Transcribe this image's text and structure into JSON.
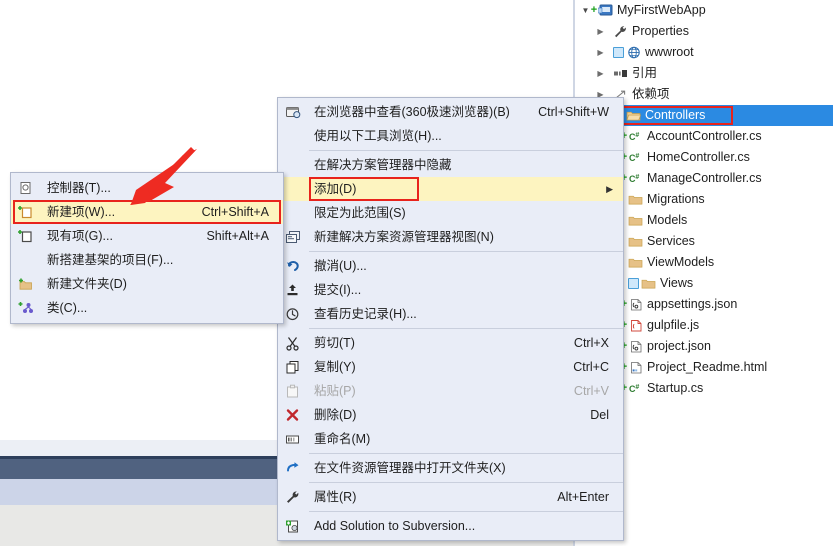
{
  "solution_explorer": {
    "name": "solution-explorer",
    "items": [
      {
        "label": "MyFirstWebApp",
        "icon": "project-icon",
        "indent": 0,
        "expander": "open",
        "plus": true,
        "selected": false
      },
      {
        "label": "Properties",
        "icon": "wrench-icon",
        "indent": 1,
        "expander": "closed",
        "plus": false,
        "selected": false
      },
      {
        "label": "wwwroot",
        "icon": "globe-icon",
        "indent": 1,
        "expander": "closed",
        "plus": false,
        "selected": false,
        "lock": true
      },
      {
        "label": "引用",
        "icon": "references-icon",
        "indent": 1,
        "expander": "closed",
        "plus": false,
        "selected": false
      },
      {
        "label": "依赖项",
        "icon": "dependencies-icon",
        "indent": 1,
        "expander": "closed",
        "plus": false,
        "selected": false
      },
      {
        "label": "Controllers",
        "icon": "folder-open-icon",
        "indent": 1,
        "expander": "open",
        "plus": false,
        "selected": true,
        "lock": true
      },
      {
        "label": "AccountController.cs",
        "icon": "csharp-icon",
        "indent": 2,
        "expander": "closed",
        "plus": true,
        "selected": false
      },
      {
        "label": "HomeController.cs",
        "icon": "csharp-icon",
        "indent": 2,
        "expander": "closed",
        "plus": true,
        "selected": false
      },
      {
        "label": "ManageController.cs",
        "icon": "csharp-icon",
        "indent": 2,
        "expander": "closed",
        "plus": true,
        "selected": false
      },
      {
        "label": "Migrations",
        "icon": "folder-icon",
        "indent": 2,
        "expander": "none",
        "plus": false,
        "selected": false
      },
      {
        "label": "Models",
        "icon": "folder-icon",
        "indent": 2,
        "expander": "none",
        "plus": false,
        "selected": false
      },
      {
        "label": "Services",
        "icon": "folder-icon",
        "indent": 2,
        "expander": "none",
        "plus": false,
        "selected": false
      },
      {
        "label": "ViewModels",
        "icon": "folder-icon",
        "indent": 2,
        "expander": "none",
        "plus": false,
        "selected": false
      },
      {
        "label": "Views",
        "icon": "folder-icon",
        "indent": 2,
        "expander": "none",
        "plus": false,
        "selected": false,
        "lock": true
      },
      {
        "label": "appsettings.json",
        "icon": "json-icon",
        "indent": 2,
        "expander": "none",
        "plus": true,
        "selected": false
      },
      {
        "label": "gulpfile.js",
        "icon": "gulp-icon",
        "indent": 2,
        "expander": "none",
        "plus": true,
        "selected": false
      },
      {
        "label": "project.json",
        "icon": "json-icon",
        "indent": 2,
        "expander": "none",
        "plus": true,
        "selected": false
      },
      {
        "label": "Project_Readme.html",
        "icon": "html-icon",
        "indent": 2,
        "expander": "none",
        "plus": true,
        "selected": false
      },
      {
        "label": "Startup.cs",
        "icon": "csharp-icon",
        "indent": 2,
        "expander": "none",
        "plus": true,
        "selected": false
      }
    ]
  },
  "context_menu": {
    "name": "solution-explorer-context-menu",
    "items": [
      {
        "type": "item",
        "label": "在浏览器中查看(360极速浏览器)(B)",
        "shortcut": "Ctrl+Shift+W",
        "icon": "browser-icon",
        "disabled": false,
        "highlight": false,
        "submenu": false
      },
      {
        "type": "item",
        "label": "使用以下工具浏览(H)...",
        "shortcut": "",
        "icon": "none",
        "disabled": false,
        "highlight": false,
        "submenu": false
      },
      {
        "type": "separator"
      },
      {
        "type": "item",
        "label": "在解决方案管理器中隐藏",
        "shortcut": "",
        "icon": "none",
        "disabled": false,
        "highlight": false,
        "submenu": false
      },
      {
        "type": "item",
        "label": "添加(D)",
        "shortcut": "",
        "icon": "none",
        "disabled": false,
        "highlight": true,
        "submenu": true
      },
      {
        "type": "item",
        "label": "限定为此范围(S)",
        "shortcut": "",
        "icon": "none",
        "disabled": false,
        "highlight": false,
        "submenu": false
      },
      {
        "type": "item",
        "label": "新建解决方案资源管理器视图(N)",
        "shortcut": "",
        "icon": "new-view-icon",
        "disabled": false,
        "highlight": false,
        "submenu": false
      },
      {
        "type": "separator"
      },
      {
        "type": "item",
        "label": "撤消(U)...",
        "shortcut": "",
        "icon": "undo-icon",
        "disabled": false,
        "highlight": false,
        "submenu": false
      },
      {
        "type": "item",
        "label": "提交(I)...",
        "shortcut": "",
        "icon": "commit-icon",
        "disabled": false,
        "highlight": false,
        "submenu": false
      },
      {
        "type": "item",
        "label": "查看历史记录(H)...",
        "shortcut": "",
        "icon": "history-icon",
        "disabled": false,
        "highlight": false,
        "submenu": false
      },
      {
        "type": "separator"
      },
      {
        "type": "item",
        "label": "剪切(T)",
        "shortcut": "Ctrl+X",
        "icon": "cut-icon",
        "disabled": false,
        "highlight": false,
        "submenu": false
      },
      {
        "type": "item",
        "label": "复制(Y)",
        "shortcut": "Ctrl+C",
        "icon": "copy-icon",
        "disabled": false,
        "highlight": false,
        "submenu": false
      },
      {
        "type": "item",
        "label": "粘贴(P)",
        "shortcut": "Ctrl+V",
        "icon": "paste-icon",
        "disabled": true,
        "highlight": false,
        "submenu": false
      },
      {
        "type": "item",
        "label": "删除(D)",
        "shortcut": "Del",
        "icon": "delete-icon",
        "disabled": false,
        "highlight": false,
        "submenu": false
      },
      {
        "type": "item",
        "label": "重命名(M)",
        "shortcut": "",
        "icon": "rename-icon",
        "disabled": false,
        "highlight": false,
        "submenu": false
      },
      {
        "type": "separator"
      },
      {
        "type": "item",
        "label": "在文件资源管理器中打开文件夹(X)",
        "shortcut": "",
        "icon": "open-folder-icon",
        "disabled": false,
        "highlight": false,
        "submenu": false
      },
      {
        "type": "separator"
      },
      {
        "type": "item",
        "label": "属性(R)",
        "shortcut": "Alt+Enter",
        "icon": "properties-icon",
        "disabled": false,
        "highlight": false,
        "submenu": false
      },
      {
        "type": "separator"
      },
      {
        "type": "item",
        "label": "Add Solution to Subversion...",
        "shortcut": "",
        "icon": "subversion-icon",
        "disabled": false,
        "highlight": false,
        "submenu": false
      }
    ]
  },
  "submenu": {
    "name": "add-submenu",
    "items": [
      {
        "label": "控制器(T)...",
        "shortcut": "",
        "icon": "controller-icon",
        "highlight": false
      },
      {
        "label": "新建项(W)...",
        "shortcut": "Ctrl+Shift+A",
        "icon": "new-item-icon",
        "highlight": true
      },
      {
        "label": "现有项(G)...",
        "shortcut": "Shift+Alt+A",
        "icon": "existing-item-icon",
        "highlight": false
      },
      {
        "label": "新搭建基架的项目(F)...",
        "shortcut": "",
        "icon": "none",
        "highlight": false
      },
      {
        "label": "新建文件夹(D)",
        "shortcut": "",
        "icon": "new-folder-icon",
        "highlight": false
      },
      {
        "label": "类(C)...",
        "shortcut": "",
        "icon": "class-icon",
        "highlight": false
      }
    ]
  },
  "annotations": {
    "arrow_color": "#e8231c",
    "highlight_box_color": "#e8231c",
    "selection_color": "#2b8ae2",
    "menu_highlight_color": "#fdf4c0"
  }
}
